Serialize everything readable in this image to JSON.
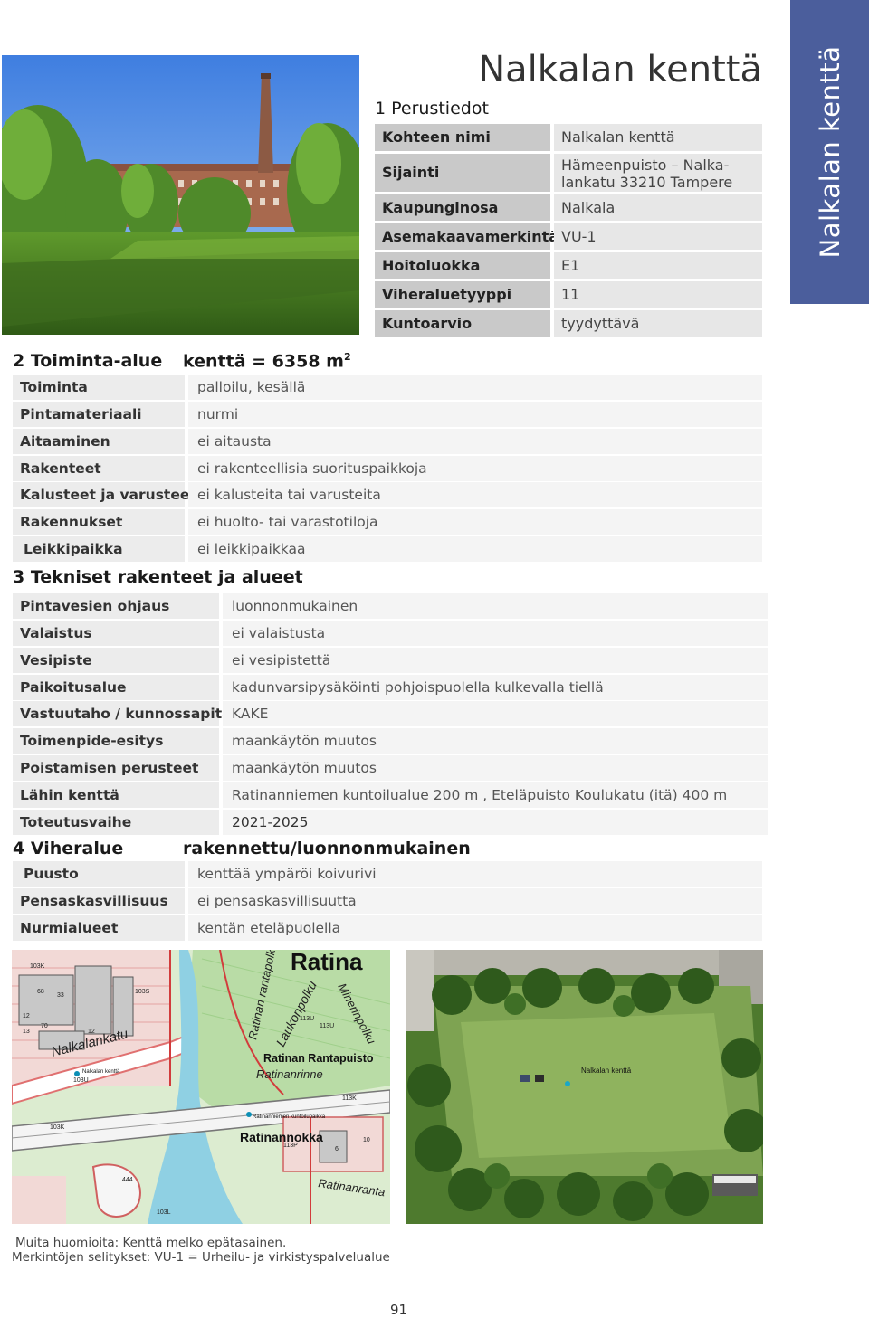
{
  "side_tab": "Nalkalan kenttä",
  "title": "Nalkalan kenttä",
  "perustiedot": {
    "heading": "1 Perustiedot",
    "rows": [
      {
        "label": "Kohteen nimi",
        "value": "Nalkalan kenttä"
      },
      {
        "label": "Sijainti",
        "value_line1": "Hämeenpuisto – Nalka-",
        "value_line2": "lankatu 33210 Tampere"
      },
      {
        "label": "Kaupunginosa",
        "value": "Nalkala"
      },
      {
        "label": "Asemakaavamerkintä",
        "value": "VU-1"
      },
      {
        "label": "Hoitoluokka",
        "value": "E1"
      },
      {
        "label": "Viheraluetyyppi",
        "value": "11"
      },
      {
        "label": "Kuntoarvio",
        "value": "tyydyttävä"
      }
    ]
  },
  "toiminta_alue": {
    "heading": "2 Toiminta-alue",
    "subheading": "kenttä = 6358 m",
    "subheading_sup": "2",
    "rows": [
      {
        "label": "Toiminta",
        "value": "palloilu, kesällä"
      },
      {
        "label": "Pintamateriaali",
        "value": "nurmi"
      },
      {
        "label": "Aitaaminen",
        "value": "ei aitausta"
      },
      {
        "label": "Rakenteet",
        "value": "ei rakenteellisia suorituspaikkoja"
      },
      {
        "label": "Kalusteet ja varusteet",
        "value": "ei kalusteita tai varusteita"
      },
      {
        "label": "Rakennukset",
        "value": "ei huolto- tai varastotiloja"
      },
      {
        "label": "Leikkipaikka",
        "value": "ei leikkipaikkaa"
      }
    ]
  },
  "tekniset": {
    "heading": "3 Tekniset rakenteet ja alueet",
    "rows": [
      {
        "label": "Pintavesien ohjaus",
        "value": "luonnonmukainen"
      },
      {
        "label": "Valaistus",
        "value": "ei valaistusta"
      },
      {
        "label": "Vesipiste",
        "value": "ei vesipistettä"
      },
      {
        "label": "Paikoitusalue",
        "value": "kadunvarsipysäköinti pohjoispuolella kulkevalla tiellä"
      },
      {
        "label": "Vastuutaho / kunnossapitäjä",
        "value": "KAKE"
      },
      {
        "label": "Toimenpide-esitys",
        "value": "maankäytön  muutos"
      },
      {
        "label": "Poistamisen perusteet",
        "value": "maankäytön  muutos"
      },
      {
        "label": "Lähin kenttä",
        "value": "Ratinanniemen kuntoilualue 200 m , Eteläpuisto Koulukatu (itä) 400 m"
      },
      {
        "label": "Toteutusvaihe",
        "value": "2021-2025"
      }
    ]
  },
  "viheralue": {
    "heading": "4 Viheralue",
    "subheading": "rakennettu/luonnonmukainen",
    "rows": [
      {
        "label": "Puusto",
        "value": "kenttää ympäröi koivurivi"
      },
      {
        "label": "Pensaskasvillisuus",
        "value": "ei pensaskasvillisuutta"
      },
      {
        "label": "Nurmialueet",
        "value": "kentän eteläpuolella"
      }
    ]
  },
  "map": {
    "labels": {
      "ratina": "Ratina",
      "nalkalankatu": "Nalkalankatu",
      "nalkalan_kentta": "Nalkalan kenttä",
      "ratinan_rantapuisto": "Ratinan Rantapuisto",
      "ratinanrinne": "Ratinanrinne",
      "ratinannokka": "Ratinannokka",
      "kuntoilupaikka": "Ratinanniemen kuntoilupaikka",
      "laukonpolku": "Laukonpolku",
      "minerinpolku": "Minerinpolku",
      "ratinanranta": "Ratinanranta",
      "ratinan_rantapolku": "Ratinan rantapolk",
      "codes": [
        "103K",
        "68",
        "33",
        "103S",
        "70",
        "12",
        "13",
        "12",
        "103U",
        "113U",
        "113U",
        "113K",
        "113P",
        "103K",
        "6",
        "444",
        "103L",
        "10"
      ]
    }
  },
  "aerial": {
    "label": "Nalkalan kenttä"
  },
  "notes": {
    "line1": "Muita huomioita: Kenttä melko epätasainen.",
    "line2": "Merkintöjen selitykset: VU-1 = Urheilu- ja virkistyspalvelualue"
  },
  "page_number": "91",
  "colors": {
    "accent": "#4b5e9c"
  }
}
